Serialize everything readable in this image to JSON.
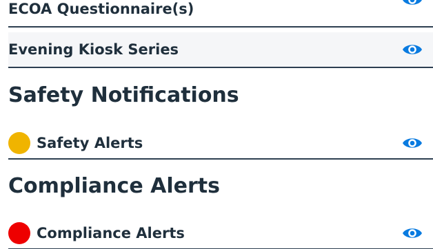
{
  "rows": {
    "ecoa": {
      "label": "ECOA Questionnaire(s)"
    },
    "evening": {
      "label": "Evening Kiosk Series"
    }
  },
  "sections": {
    "safety": {
      "title": "Safety Notifications",
      "item": {
        "label": "Safety Alerts",
        "status_color": "#f0b400"
      }
    },
    "compliance": {
      "title": "Compliance Alerts",
      "item": {
        "label": "Compliance Alerts",
        "status_color": "#ee0000"
      }
    }
  },
  "icons": {
    "view": "eye-icon"
  },
  "colors": {
    "accent": "#0a7be0",
    "text": "#1f2f3c",
    "divider": "#2c3e50"
  }
}
